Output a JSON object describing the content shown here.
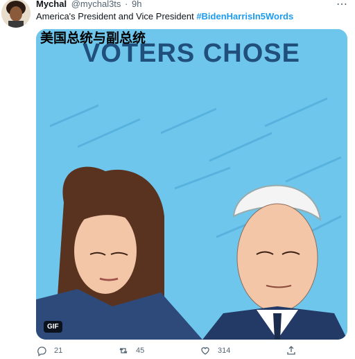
{
  "tweet": {
    "author_name": "Mychal",
    "handle": "@mychal3ts",
    "separator": "·",
    "time": "9h",
    "more_icon": "more-horizontal-icon",
    "text": "America's President and Vice President ",
    "hashtag": "#BidenHarrisIn5Words"
  },
  "media": {
    "overlay_caption": "美国总统与副总统",
    "gif_headline": "VOTERS CHOSE",
    "badge": "GIF",
    "background_color": "#6fc6ec"
  },
  "actions": {
    "reply_count": "21",
    "retweet_count": "45",
    "like_count": "314"
  },
  "colors": {
    "link": "#1d9bf0",
    "text": "#0f1419",
    "muted": "#536471"
  }
}
